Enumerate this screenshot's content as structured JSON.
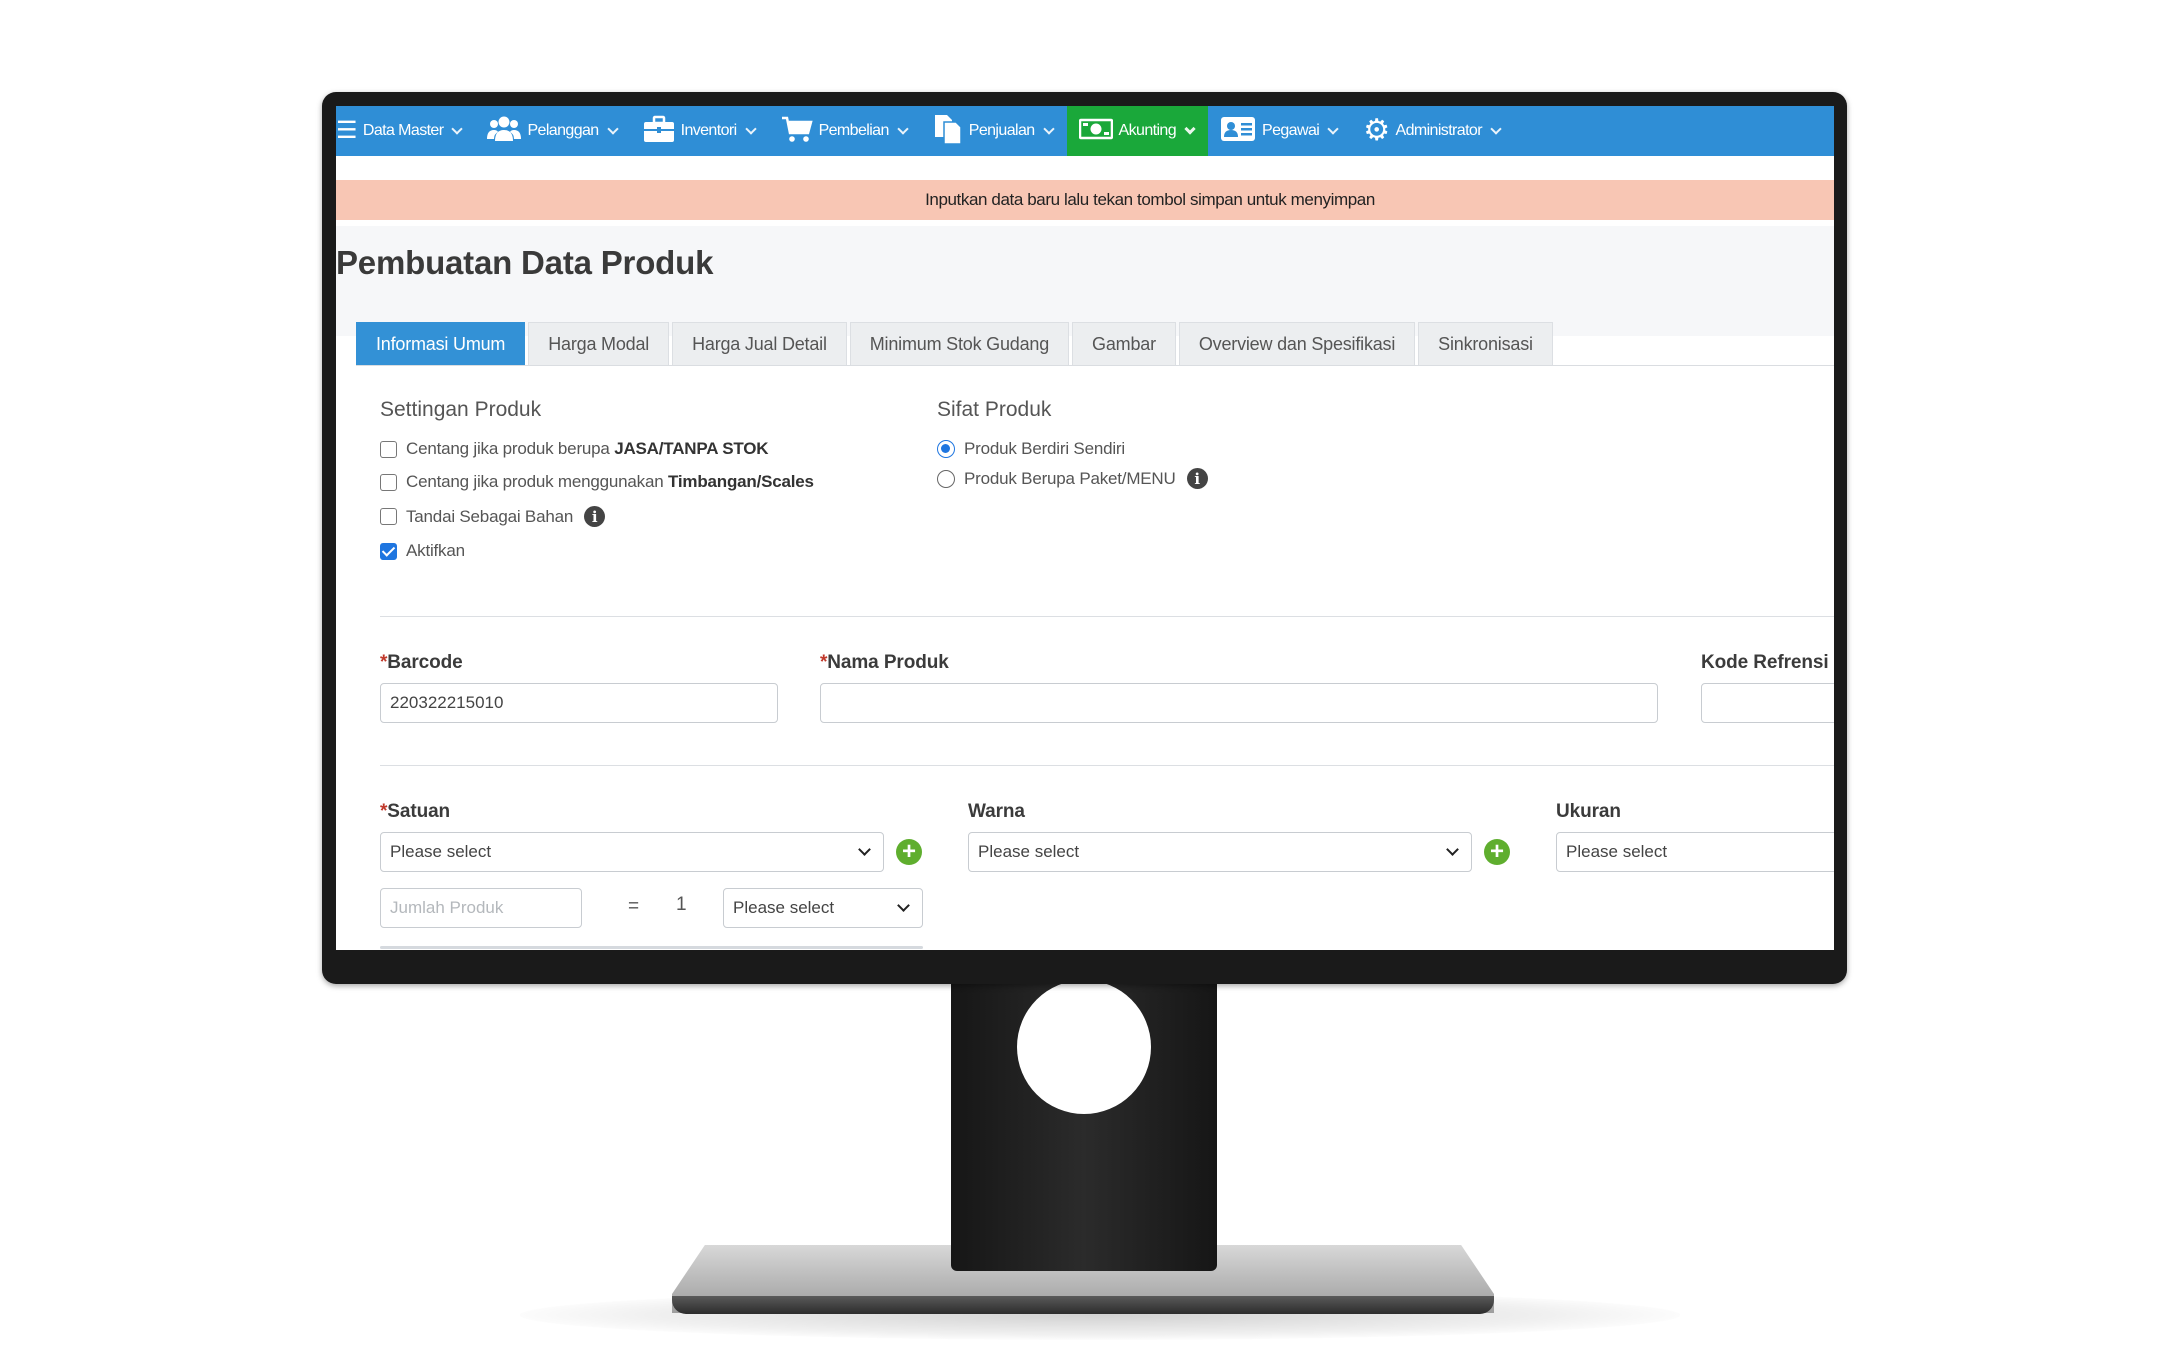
{
  "navbar": {
    "items": [
      {
        "label": "Data Master",
        "icon": "menu-icon"
      },
      {
        "label": "Pelanggan",
        "icon": "users-icon"
      },
      {
        "label": "Inventori",
        "icon": "briefcase-icon"
      },
      {
        "label": "Pembelian",
        "icon": "cart-icon"
      },
      {
        "label": "Penjualan",
        "icon": "documents-icon"
      },
      {
        "label": "Akunting",
        "icon": "money-icon",
        "active": true
      },
      {
        "label": "Pegawai",
        "icon": "id-card-icon"
      },
      {
        "label": "Administrator",
        "icon": "gear-icon"
      }
    ]
  },
  "alert": {
    "message": "Inputkan data baru lalu tekan tombol simpan untuk menyimpan"
  },
  "page": {
    "title": "Pembuatan Data Produk"
  },
  "tabs": [
    "Informasi Umum",
    "Harga Modal",
    "Harga Jual Detail",
    "Minimum Stok Gudang",
    "Gambar",
    "Overview dan Spesifikasi",
    "Sinkronisasi"
  ],
  "settings": {
    "title": "Settingan Produk",
    "jasa_prefix": "Centang jika produk berupa",
    "jasa_bold": "JASA/TANPA STOK",
    "timbangan_prefix": "Centang jika produk menggunakan",
    "timbangan_bold": "Timbangan/Scales",
    "bahan_label": "Tandai Sebagai Bahan",
    "aktifkan_label": "Aktifkan",
    "aktifkan_checked": true
  },
  "sifat": {
    "title": "Sifat Produk",
    "option1": "Produk Berdiri Sendiri",
    "option2": "Produk Berupa Paket/MENU",
    "selected": "Produk Berdiri Sendiri"
  },
  "form": {
    "required_mark": "*",
    "barcode_label": "Barcode",
    "barcode_value": "220322215010",
    "nama_label": "Nama Produk",
    "nama_value": "",
    "kode_label": "Kode Refrensi",
    "satuan_label": "Satuan",
    "satuan_value": "Please select",
    "warna_label": "Warna",
    "warna_value": "Please select",
    "ukuran_label": "Ukuran",
    "ukuran_value": "Please select",
    "jumlah_placeholder": "Jumlah Produk",
    "equals": "=",
    "one": "1",
    "konversi_value": "Please select"
  },
  "colors": {
    "navbar": "#2f8ed6",
    "active_nav": "#1aa83a",
    "alert": "#f8c6b4",
    "active_tab": "#3391d6",
    "plus_button": "#5fae2e"
  }
}
